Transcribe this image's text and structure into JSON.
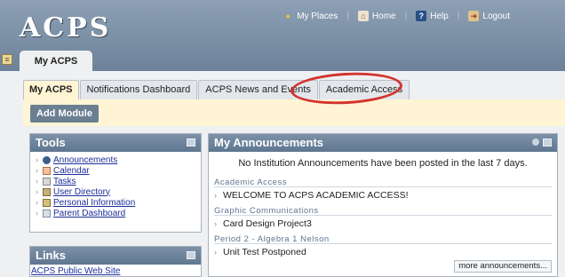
{
  "header": {
    "logo_text": "ACPS",
    "top_links": {
      "my_places": "My Places",
      "home": "Home",
      "help": "Help",
      "logout": "Logout"
    },
    "main_tab": "My ACPS"
  },
  "subtabs": [
    "My ACPS",
    "Notifications Dashboard",
    "ACPS News and Events",
    "Academic Access"
  ],
  "toolbar": {
    "add_module": "Add Module"
  },
  "tools": {
    "title": "Tools",
    "items": [
      "Announcements",
      "Calendar",
      "Tasks",
      "User Directory",
      "Personal Information",
      "Parent Dashboard"
    ]
  },
  "links": {
    "title": "Links",
    "items": [
      "ACPS Public Web Site"
    ]
  },
  "announcements": {
    "title": "My Announcements",
    "empty_message": "No Institution Announcements have been posted in the last 7 days.",
    "groups": [
      {
        "category": "Academic Access",
        "item": "WELCOME TO ACPS ACADEMIC ACCESS!"
      },
      {
        "category": "Graphic Communications",
        "item": "Card Design Project3"
      },
      {
        "category": "Period 2 - Algebra 1 Nelson",
        "item": "Unit Test Postponed"
      }
    ],
    "more_button": "more announcements..."
  },
  "colors": {
    "header_blue": "#6d8299",
    "highlight_red": "#d3332e",
    "link_blue": "#1c2f9a",
    "tab_band_yellow": "#fff4d4"
  }
}
